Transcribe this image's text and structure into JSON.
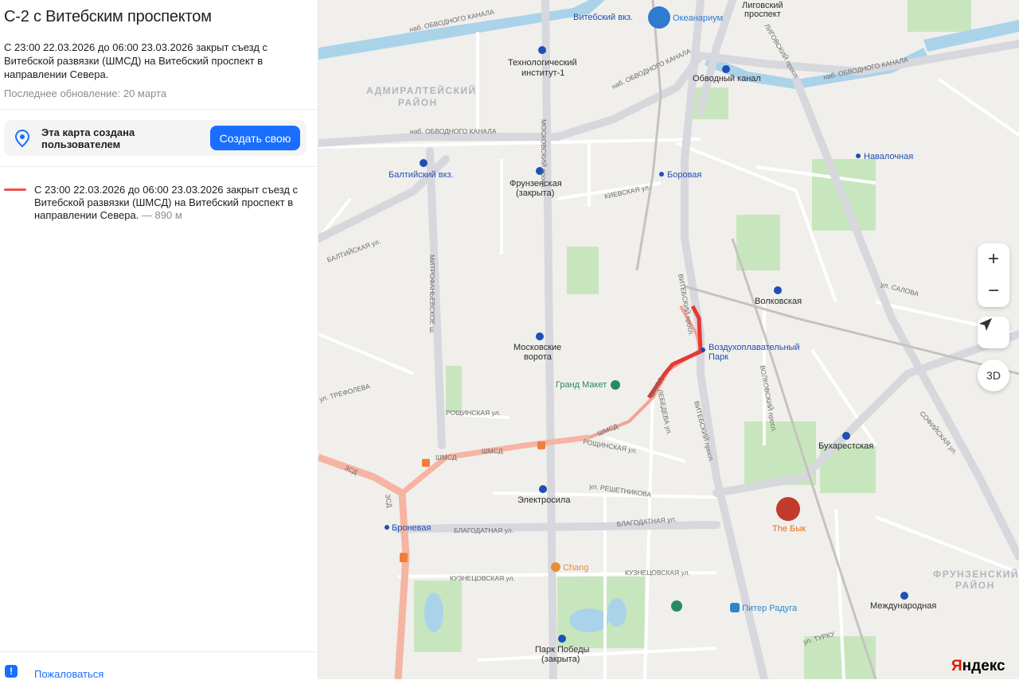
{
  "sidebar": {
    "title": "С-2 с Витебским проспектом",
    "description": "С 23:00 22.03.2026 до 06:00 23.03.2026 закрыт съезд с Витебской развязки (ШМСД) на Витебский проспект в направлении Севера.",
    "updated": "Последнее обновление: 20 марта",
    "creator_note": "Эта карта создана пользователем",
    "create_button": "Создать свою",
    "route_item": {
      "text": "С 23:00 22.03.2026 до 06:00 23.03.2026 закрыт съезд с Витебской развязки (ШМСД) на Витебский проспект в направлении Севера.",
      "distance": " — 890 м",
      "color": "#f05151"
    },
    "complain_label": "Пожаловаться"
  },
  "map_labels": {
    "metro": [
      {
        "id": "vitebsky",
        "text": "Витебский вкз."
      },
      {
        "id": "tech",
        "text": "Технологический"
      },
      {
        "id": "tech2",
        "text": "институт-1"
      },
      {
        "id": "obvodny",
        "text": "Обводный канал"
      },
      {
        "id": "baltic",
        "text": "Балтийский вкз."
      },
      {
        "id": "frunz",
        "text": "Фрунзенская"
      },
      {
        "id": "frunz2",
        "text": "(закрыта)"
      },
      {
        "id": "borovaya",
        "text": "Боровая"
      },
      {
        "id": "navalochnaya",
        "text": "Навалочная"
      },
      {
        "id": "volkovskaya",
        "text": "Волковская"
      },
      {
        "id": "mosvorota",
        "text": "Московские"
      },
      {
        "id": "mosvorota2",
        "text": "ворота"
      },
      {
        "id": "vozdukh",
        "text": "Воздухоплавательный"
      },
      {
        "id": "vozdukh2",
        "text": "Парк"
      },
      {
        "id": "buharest",
        "text": "Бухарестская"
      },
      {
        "id": "electrosila",
        "text": "Электросила"
      },
      {
        "id": "bronevaya",
        "text": "Броневая"
      },
      {
        "id": "mezhd",
        "text": "Международная"
      },
      {
        "id": "parkpob",
        "text": "Парк Победы"
      },
      {
        "id": "parkpob2",
        "text": "(закрыта)"
      },
      {
        "id": "ligov",
        "text": "Лиговский"
      },
      {
        "id": "ligov2",
        "text": "проспект"
      }
    ],
    "districts": [
      {
        "id": "admir",
        "text": "АДМИРАЛТЕЙСКИЙ"
      },
      {
        "id": "admir2",
        "text": "РАЙОН"
      },
      {
        "id": "frunzr",
        "text": "ФРУНЗЕНСКИЙ"
      },
      {
        "id": "frunzr2",
        "text": "РАЙОН"
      }
    ],
    "poi": [
      {
        "id": "okeanarium",
        "text": "Океанариум"
      },
      {
        "id": "grandmaket",
        "text": "Гранд Макет"
      },
      {
        "id": "thebyk",
        "text": "The Бык"
      },
      {
        "id": "chang",
        "text": "Chang"
      },
      {
        "id": "piter",
        "text": "Питер Радуга"
      }
    ],
    "streets": [
      {
        "id": "s1",
        "text": "наб. ОБВОДНОГО КАНАЛА"
      },
      {
        "id": "s2",
        "text": "наб. ОБВОДНОГО КАНАЛА"
      },
      {
        "id": "s3",
        "text": "наб. ОБВОДНОГО КАНАЛА"
      },
      {
        "id": "s4",
        "text": "наб. ОБВОДНОГО КАНАЛА"
      },
      {
        "id": "s5",
        "text": "МОСКОВСКИЙ просп."
      },
      {
        "id": "s6",
        "text": "МИТРОФАНЬЕВСКОЕ ш."
      },
      {
        "id": "s7",
        "text": "ВИТЕБСКИЙ просп."
      },
      {
        "id": "s8",
        "text": "ВИТЕБСКИЙ просп."
      },
      {
        "id": "s9",
        "text": "БЛАГОДАТНАЯ ул."
      },
      {
        "id": "s10",
        "text": "БЛАГОДАТНАЯ ул."
      },
      {
        "id": "s11",
        "text": "ШМСД"
      },
      {
        "id": "s12",
        "text": "ШМСД"
      },
      {
        "id": "s13",
        "text": "ШМСД"
      },
      {
        "id": "s14",
        "text": "ШМСД"
      },
      {
        "id": "s15",
        "text": "ЗСД"
      },
      {
        "id": "s16",
        "text": "ЗСД"
      },
      {
        "id": "s17",
        "text": "КУЗНЕЦОВСКАЯ ул."
      },
      {
        "id": "s18",
        "text": "КУЗНЕЦОВСКАЯ ул."
      },
      {
        "id": "s19",
        "text": "РОЩИНСКАЯ ул."
      },
      {
        "id": "s20",
        "text": "РОЩИНСКАЯ ул."
      },
      {
        "id": "s21",
        "text": "ул. РЕШЕТНИКОВА"
      },
      {
        "id": "s22",
        "text": "ул. ТРЕФОЛЕВА"
      },
      {
        "id": "s23",
        "text": "БАЛТИЙСКАЯ ул."
      },
      {
        "id": "s24",
        "text": "ул. САЛОВА"
      },
      {
        "id": "s25",
        "text": "СОФИЙСКАЯ ул."
      },
      {
        "id": "s26",
        "text": "КИЕВСКАЯ ул."
      },
      {
        "id": "s27",
        "text": "ЛИГОВСКИЙ просп."
      },
      {
        "id": "s28",
        "text": "ул. ТУРКУ"
      },
      {
        "id": "s29",
        "text": "ВОЛКОВСКИЙ просп."
      },
      {
        "id": "s30",
        "text": "ЛЕБЕДЕВА ул."
      }
    ]
  },
  "map_controls": {
    "zoom_in": "+",
    "zoom_out": "−",
    "three_d": "3D"
  },
  "brand": {
    "first": "Я",
    "rest": "ндекс"
  }
}
